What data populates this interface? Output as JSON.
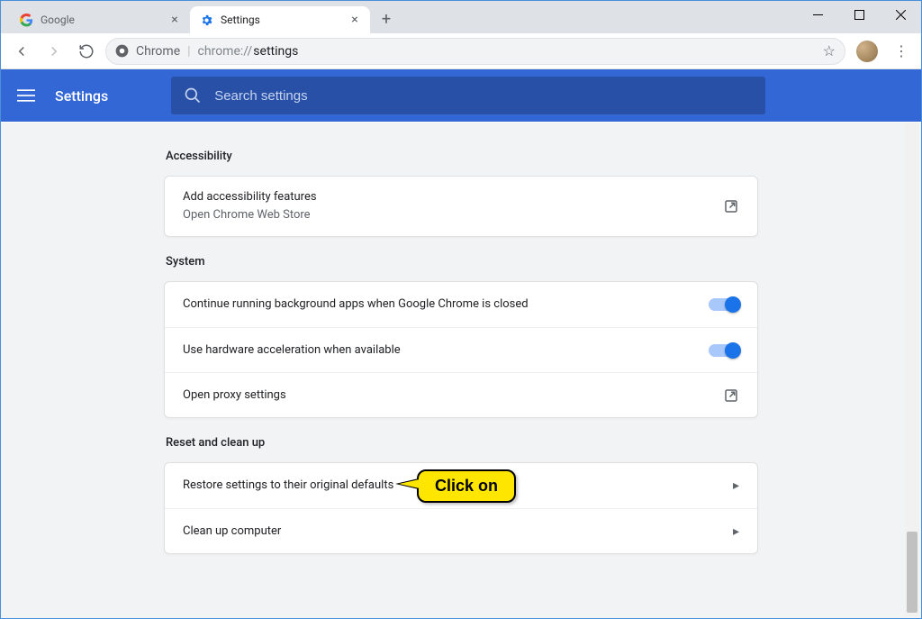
{
  "window": {
    "tabs": [
      {
        "title": "Google",
        "active": false
      },
      {
        "title": "Settings",
        "active": true
      }
    ],
    "controls": {
      "minimize": "—",
      "maximize": "☐",
      "close": "✕"
    }
  },
  "toolbar": {
    "url_host": "Chrome",
    "url_path_prefix": "chrome://",
    "url_path_bold": "settings"
  },
  "header": {
    "title": "Settings",
    "search_placeholder": "Search settings"
  },
  "sections": {
    "accessibility": {
      "title": "Accessibility",
      "row_title": "Add accessibility features",
      "row_sub": "Open Chrome Web Store"
    },
    "system": {
      "title": "System",
      "row1": "Continue running background apps when Google Chrome is closed",
      "row2": "Use hardware acceleration when available",
      "row3": "Open proxy settings",
      "toggle1": true,
      "toggle2": true
    },
    "reset": {
      "title": "Reset and clean up",
      "row1": "Restore settings to their original defaults",
      "row2": "Clean up computer"
    }
  },
  "callout": {
    "text": "Click on"
  }
}
